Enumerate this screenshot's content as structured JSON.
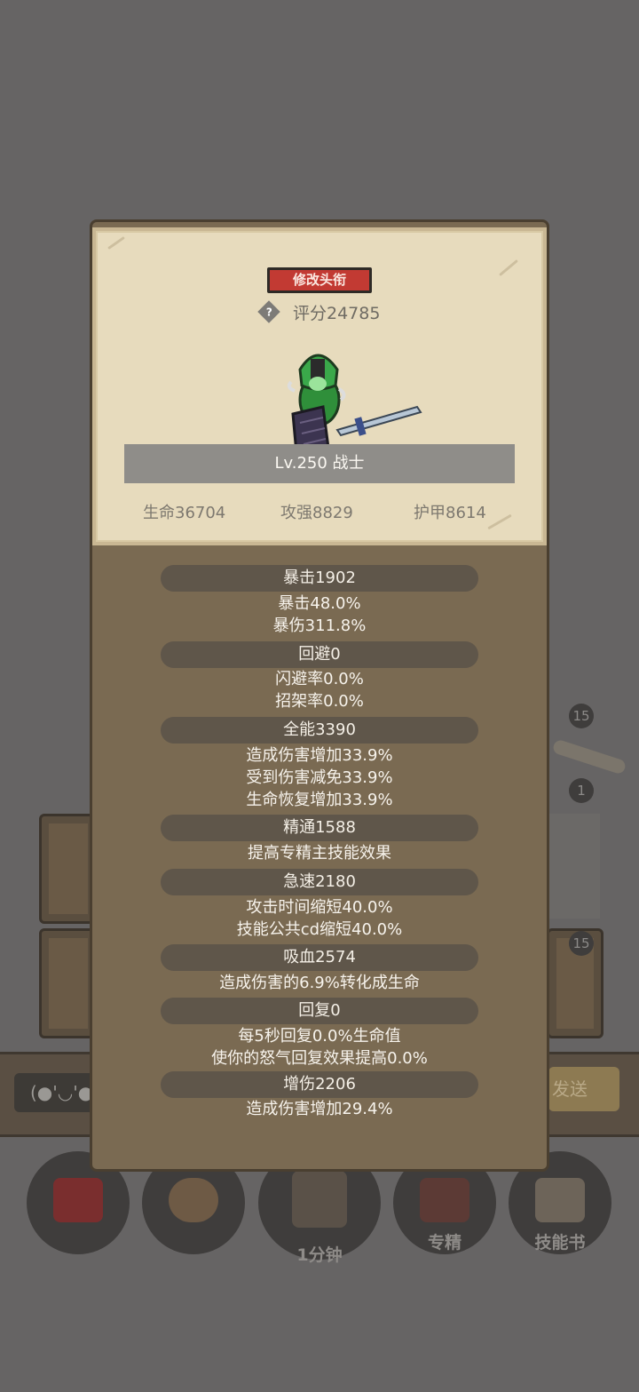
{
  "background": {
    "badge_top": "15",
    "badge_mid": "1",
    "badge_right": "15",
    "chat_text": "(●'◡'●",
    "send_label": "发送",
    "timer_label": "1分钟",
    "specialize_label": "专精",
    "skillbook_label": "技能书"
  },
  "dialog": {
    "rename_label": "修改头衔",
    "score_text": "评分24785",
    "level_text": "Lv.250 战士",
    "attributes": {
      "hp": "生命36704",
      "attack": "攻强8829",
      "armor": "护甲8614"
    },
    "stats": [
      {
        "title": "暴击1902",
        "lines": [
          "暴击48.0%",
          "暴伤311.8%"
        ]
      },
      {
        "title": "回避0",
        "lines": [
          "闪避率0.0%",
          "招架率0.0%"
        ]
      },
      {
        "title": "全能3390",
        "lines": [
          "造成伤害增加33.9%",
          "受到伤害减免33.9%",
          "生命恢复增加33.9%"
        ]
      },
      {
        "title": "精通1588",
        "lines": [
          "提高专精主技能效果"
        ]
      },
      {
        "title": "急速2180",
        "lines": [
          "攻击时间缩短40.0%",
          "技能公共cd缩短40.0%"
        ]
      },
      {
        "title": "吸血2574",
        "lines": [
          "造成伤害的6.9%转化成生命"
        ]
      },
      {
        "title": "回复0",
        "lines": [
          "每5秒回复0.0%生命值",
          "使你的怒气回复效果提高0.0%"
        ]
      },
      {
        "title": "增伤2206",
        "lines": [
          "造成伤害增加29.4%"
        ]
      }
    ]
  },
  "colors": {
    "overlay": "#666464",
    "dialog_brown": "#7a6a52",
    "parchment": "#e7dbbd",
    "rename_red": "#c23a33",
    "pill": "#5f564a"
  }
}
